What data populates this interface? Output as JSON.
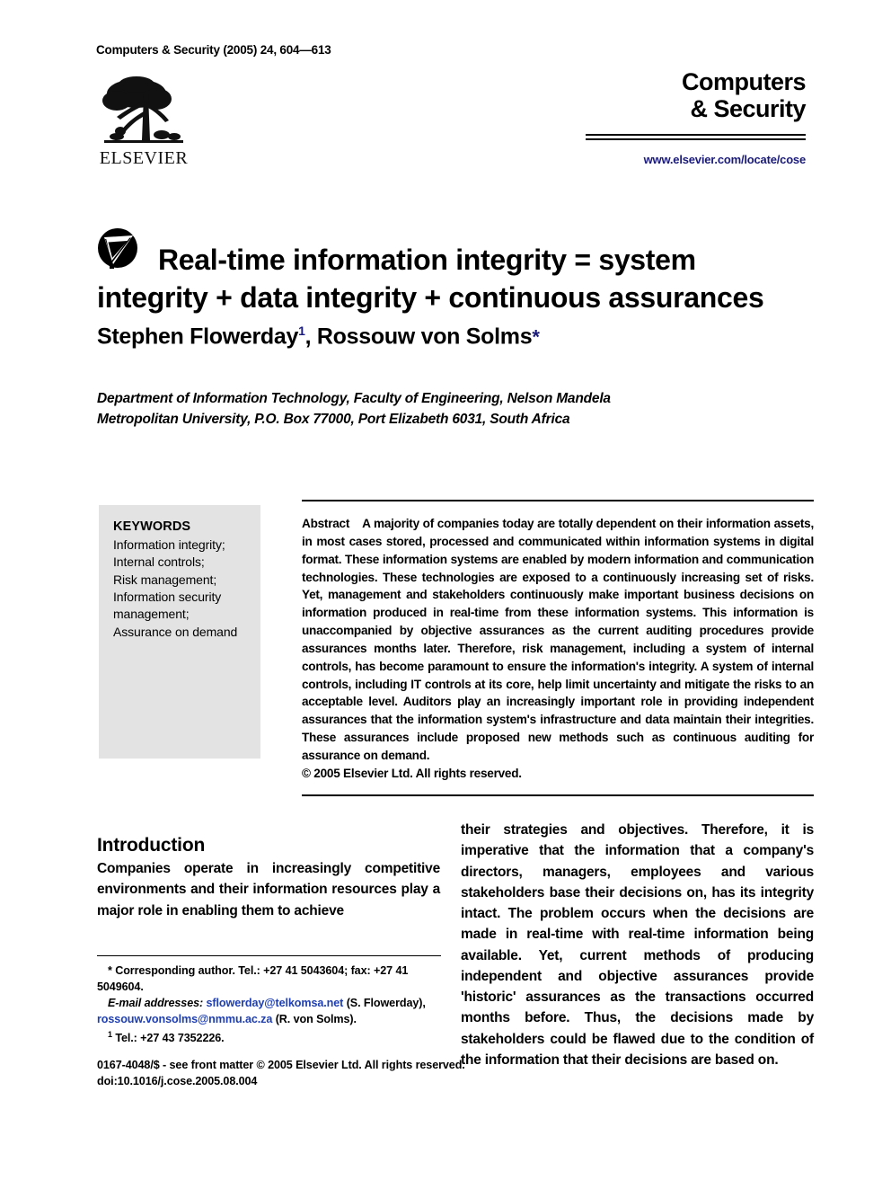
{
  "running_head": "Computers & Security (2005) 24, 604—613",
  "masthead": {
    "journal_title_line1": "Computers",
    "journal_title_line2": "& Security",
    "url": "www.elsevier.com/locate/cose",
    "url_color": "#1a1a7a"
  },
  "publisher": {
    "name": "ELSEVIER",
    "logo_icon": "elsevier-tree-logo"
  },
  "article": {
    "icon": "sciencedirect-icon",
    "title_line1": "Real-time information integrity = system",
    "title_line2": "integrity + data integrity + continuous assurances",
    "authors": {
      "author1_name": "Stephen Flowerday",
      "author1_marker": "1",
      "separator": ", ",
      "author2_name": "Rossouw von Solms",
      "author2_marker": "*"
    },
    "affiliation_line1": "Department of Information Technology, Faculty of Engineering, Nelson Mandela",
    "affiliation_line2": "Metropolitan University, P.O. Box 77000, Port Elizabeth 6031, South Africa"
  },
  "keywords": {
    "heading": "KEYWORDS",
    "items": [
      "Information integrity;",
      "Internal controls;",
      "Risk management;",
      "Information security",
      "management;",
      "Assurance on demand"
    ]
  },
  "abstract": {
    "label": "Abstract",
    "text": "A majority of companies today are totally dependent on their information assets, in most cases stored, processed and communicated within information systems in digital format. These information systems are enabled by modern information and communication technologies. These technologies are exposed to a continuously increasing set of risks. Yet, management and stakeholders continuously make important business decisions on information produced in real-time from these information systems. This information is unaccompanied by objective assurances as the current auditing procedures provide assurances months later. Therefore, risk management, including a system of internal controls, has become paramount to ensure the information's integrity. A system of internal controls, including IT controls at its core, help limit uncertainty and mitigate the risks to an acceptable level. Auditors play an increasingly important role in providing independent assurances that the information system's infrastructure and data maintain their integrities. These assurances include proposed new methods such as continuous auditing for assurance on demand.",
    "copyright": "© 2005 Elsevier Ltd. All rights reserved."
  },
  "body": {
    "section_heading": "Introduction",
    "column_left": "Companies operate in increasingly competitive environments and their information resources play a major role in enabling them to achieve",
    "column_right": "their strategies and objectives. Therefore, it is imperative that the information that a company's directors, managers, employees and various stakeholders base their decisions on, has its integrity intact. The problem occurs when the decisions are made in real-time with real-time information being available. Yet, current methods of producing independent and objective assurances provide 'historic' assurances as the transactions occurred months before. Thus, the decisions made by stakeholders could be flawed due to the condition of the information that their decisions are based on."
  },
  "footnotes": {
    "corresponding_marker": "*",
    "corresponding": "Corresponding author. Tel.: +27 41 5043604; fax: +27 41 5049604.",
    "email_label": "E-mail addresses:",
    "email1": "sflowerday@telkomsa.net",
    "email1_owner": "(S. Flowerday),",
    "email2": "rossouw.vonsolms@nmmu.ac.za",
    "email2_owner": "(R. von Solms).",
    "note1_marker": "1",
    "note1": "Tel.: +27 43 7352226.",
    "email_color": "#1f3fb0"
  },
  "imprint": {
    "line1": "0167-4048/$ - see front matter © 2005 Elsevier Ltd. All rights reserved.",
    "line2": "doi:10.1016/j.cose.2005.08.004"
  }
}
